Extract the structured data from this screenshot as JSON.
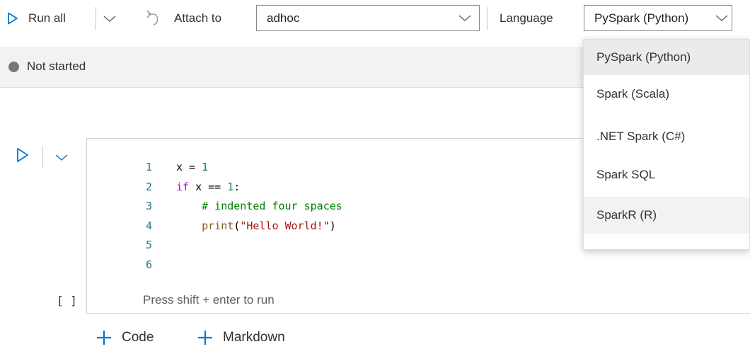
{
  "toolbar": {
    "run_all_label": "Run all",
    "attach_to_label": "Attach to",
    "attach_to_value": "adhoc",
    "language_label": "Language",
    "language_value": "PySpark (Python)"
  },
  "status": {
    "text": "Not started"
  },
  "language_dropdown": {
    "options": [
      "PySpark (Python)",
      "Spark (Scala)",
      ".NET Spark (C#)",
      "Spark SQL",
      "SparkR (R)"
    ],
    "selected": "PySpark (Python)"
  },
  "cell": {
    "execution_count": "[ ]",
    "hint": "Press shift + enter to run",
    "lines": [
      {
        "num": "1",
        "tokens": [
          {
            "t": "x = ",
            "c": "txt"
          },
          {
            "t": "1",
            "c": "num"
          }
        ]
      },
      {
        "num": "2",
        "tokens": [
          {
            "t": "if",
            "c": "kw"
          },
          {
            "t": " x == ",
            "c": "txt"
          },
          {
            "t": "1",
            "c": "num"
          },
          {
            "t": ":",
            "c": "txt"
          }
        ]
      },
      {
        "num": "3",
        "tokens": [
          {
            "t": "    ",
            "c": "txt"
          },
          {
            "t": "# indented four spaces",
            "c": "cmt"
          }
        ]
      },
      {
        "num": "4",
        "tokens": [
          {
            "t": "    ",
            "c": "txt"
          },
          {
            "t": "print",
            "c": "fn"
          },
          {
            "t": "(",
            "c": "txt"
          },
          {
            "t": "\"Hello World!\"",
            "c": "str"
          },
          {
            "t": ")",
            "c": "txt"
          }
        ]
      },
      {
        "num": "5",
        "tokens": []
      },
      {
        "num": "6",
        "tokens": []
      }
    ]
  },
  "add_buttons": {
    "code_label": "Code",
    "markdown_label": "Markdown"
  },
  "colors": {
    "accent": "#0078d4",
    "status_grey": "#797775"
  }
}
